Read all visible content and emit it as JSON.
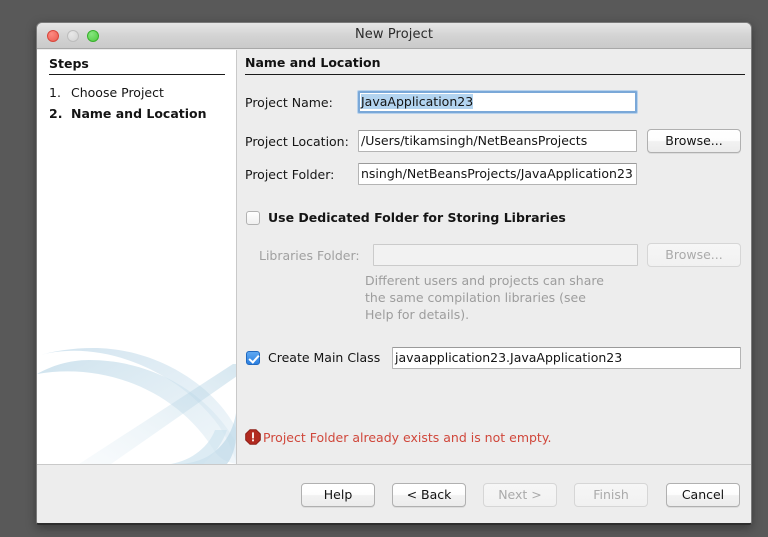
{
  "window": {
    "title": "New Project",
    "controls": [
      {
        "name": "close",
        "color": "#eb5b50"
      },
      {
        "name": "minimize",
        "color": "#d2d2d2"
      },
      {
        "name": "maximize",
        "color": "#4fcb3e"
      }
    ]
  },
  "steps": {
    "header": "Steps",
    "items": [
      {
        "number": "1.",
        "label": "Choose Project",
        "current": false
      },
      {
        "number": "2.",
        "label": "Name and Location",
        "current": true
      }
    ]
  },
  "form": {
    "header": "Name and Location",
    "project_name": {
      "label": "Project Name:",
      "value": "JavaApplication23",
      "selected": true,
      "focused": true
    },
    "project_location": {
      "label": "Project Location:",
      "value": "/Users/tikamsingh/NetBeansProjects",
      "browse_label": "Browse...",
      "browse_enabled": true
    },
    "project_folder": {
      "label": "Project Folder:",
      "value": "nsingh/NetBeansProjects/JavaApplication23"
    },
    "dedicated_folder": {
      "label": "Use Dedicated Folder for Storing Libraries",
      "checked": false
    },
    "libraries_folder": {
      "label": "Libraries Folder:",
      "value": "",
      "enabled": false,
      "browse_label": "Browse...",
      "browse_enabled": false
    },
    "helper_text": "Different users and projects can share the same compilation libraries (see Help for details).",
    "create_main_class": {
      "label": "Create Main Class",
      "checked": true,
      "value": "javaapplication23.JavaApplication23"
    },
    "error": {
      "icon": "error-octagon-icon",
      "message": "Project Folder already exists and is not empty.",
      "color": "#d0473b"
    }
  },
  "footer": {
    "buttons": [
      {
        "label": "Help",
        "enabled": true,
        "name": "help-button"
      },
      {
        "label": "< Back",
        "enabled": true,
        "name": "back-button"
      },
      {
        "label": "Next >",
        "enabled": false,
        "name": "next-button"
      },
      {
        "label": "Finish",
        "enabled": false,
        "name": "finish-button"
      },
      {
        "label": "Cancel",
        "enabled": true,
        "name": "cancel-button"
      }
    ]
  }
}
